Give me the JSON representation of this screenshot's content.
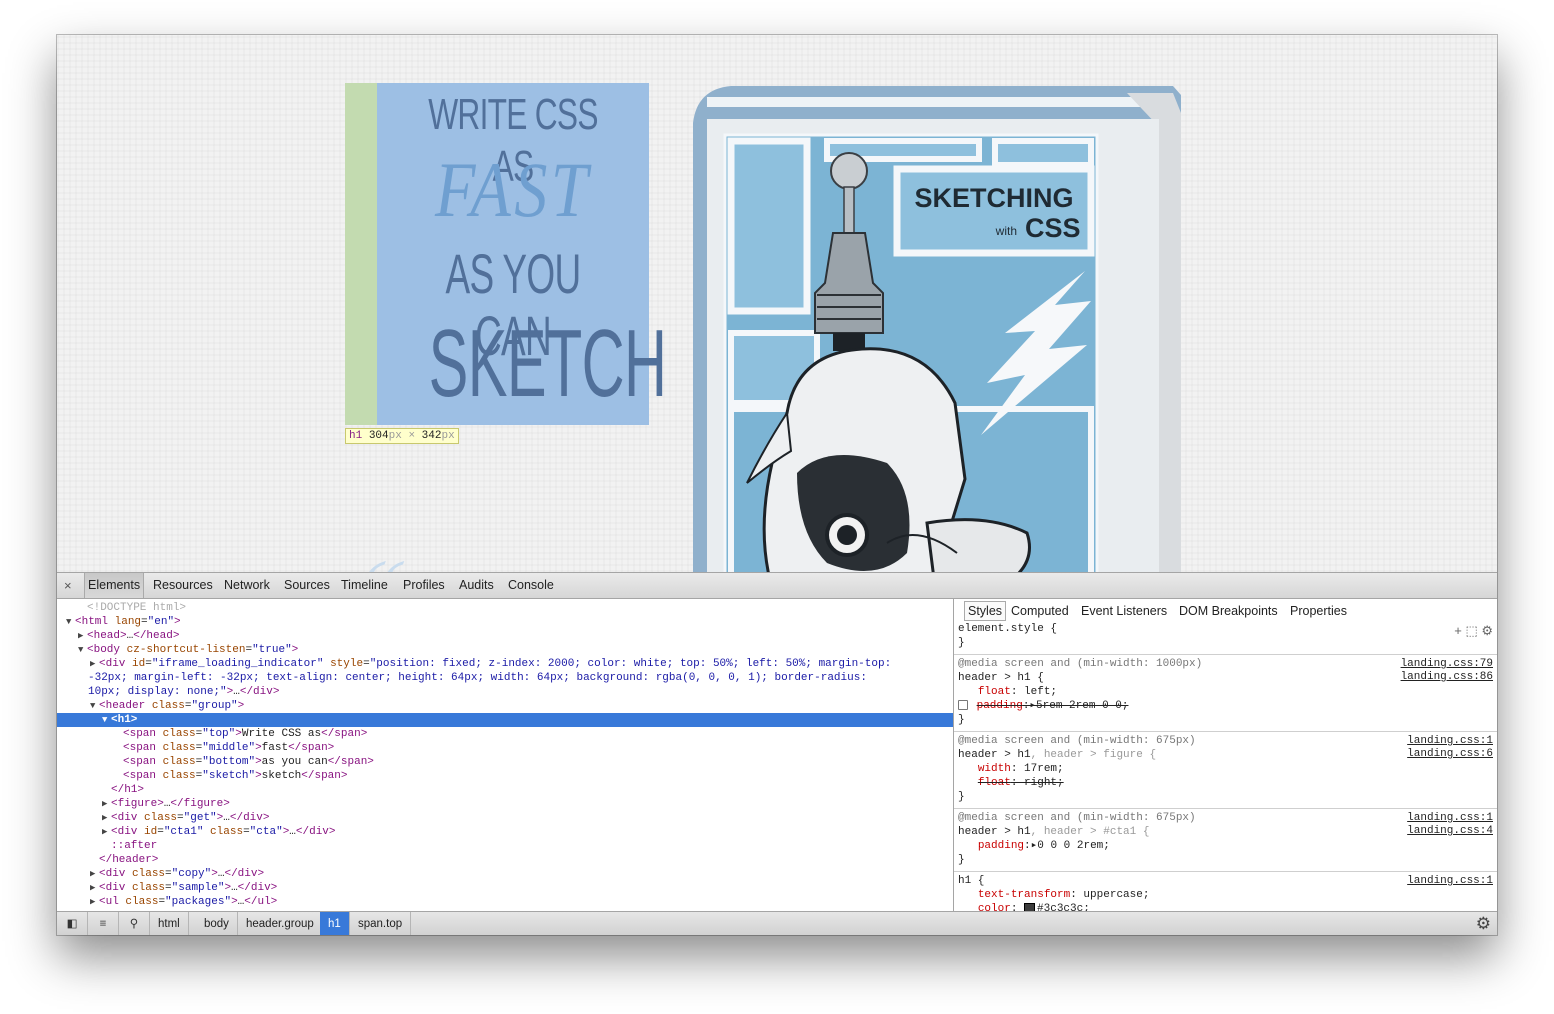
{
  "page": {
    "h1": {
      "top": "Write CSS as",
      "middle": "fast",
      "bottom": "as you can",
      "sketch": "sketch"
    },
    "dimension_tooltip": {
      "tag": "h1",
      "width": "304",
      "height": "342",
      "unit": "px",
      "times": "×"
    },
    "book": {
      "title": "SKETCHING",
      "with": "with",
      "css": "CSS"
    },
    "colors": {
      "h1_background": "#9dbfe4",
      "padding_highlight": "#c3dbb0",
      "selection": "#3879d9"
    }
  },
  "devtools": {
    "close": "×",
    "tabs": [
      "Elements",
      "Resources",
      "Network",
      "Sources",
      "Timeline",
      "Profiles",
      "Audits",
      "Console"
    ],
    "selected_tab": "Elements",
    "dom_lines": [
      {
        "indent": 1,
        "tri": "",
        "html": "<span class='dt'>&lt;!DOCTYPE html&gt;</span>"
      },
      {
        "indent": 0,
        "tri": "▼",
        "html": "<span class='tag'>&lt;html</span> <span class='an'>lang</span>=<span class='av'>\"en\"</span><span class='tag'>&gt;</span>"
      },
      {
        "indent": 1,
        "tri": "▶",
        "html": "<span class='tag'>&lt;head&gt;</span>…<span class='tag'>&lt;/head&gt;</span>"
      },
      {
        "indent": 1,
        "tri": "▼",
        "html": "<span class='tag'>&lt;body</span> <span class='an'>cz-shortcut-listen</span>=<span class='av'>\"true\"</span><span class='tag'>&gt;</span>"
      },
      {
        "indent": 2,
        "tri": "▶",
        "html": "<span class='tag'>&lt;div</span> <span class='an'>id</span>=<span class='av'>\"iframe_loading_indicator\"</span> <span class='an'>style</span>=<span class='av'>\"position: fixed; z-index: 2000; color: white; top: 50%; left: 50%; margin-top:</span>"
      },
      {
        "indent": -1,
        "tri": "",
        "html": "<span class='av'>-32px; margin-left: -32px; text-align: center; height: 64px; width: 64px; background: rgba(0, 0, 0, 1); border-radius:</span>"
      },
      {
        "indent": -1,
        "tri": "",
        "html": "<span class='av'>10px; display: none;\"</span><span class='tag'>&gt;</span>…<span class='tag'>&lt;/div&gt;</span>"
      },
      {
        "indent": 2,
        "tri": "▼",
        "html": "<span class='tag'>&lt;header</span> <span class='an'>class</span>=<span class='av'>\"group\"</span><span class='tag'>&gt;</span>"
      },
      {
        "indent": 3,
        "tri": "▼",
        "html": "<span class='tag'>&lt;h1&gt;</span>",
        "selected": true
      },
      {
        "indent": 4,
        "tri": "",
        "html": "<span class='tag'>&lt;span</span> <span class='an'>class</span>=<span class='av'>\"top\"</span><span class='tag'>&gt;</span>Write CSS as<span class='tag'>&lt;/span&gt;</span>"
      },
      {
        "indent": 4,
        "tri": "",
        "html": "<span class='tag'>&lt;span</span> <span class='an'>class</span>=<span class='av'>\"middle\"</span><span class='tag'>&gt;</span>fast<span class='tag'>&lt;/span&gt;</span>"
      },
      {
        "indent": 4,
        "tri": "",
        "html": "<span class='tag'>&lt;span</span> <span class='an'>class</span>=<span class='av'>\"bottom\"</span><span class='tag'>&gt;</span>as you can<span class='tag'>&lt;/span&gt;</span>"
      },
      {
        "indent": 4,
        "tri": "",
        "html": "<span class='tag'>&lt;span</span> <span class='an'>class</span>=<span class='av'>\"sketch\"</span><span class='tag'>&gt;</span>sketch<span class='tag'>&lt;/span&gt;</span>"
      },
      {
        "indent": 3,
        "tri": "",
        "html": "<span class='tag'>&lt;/h1&gt;</span>"
      },
      {
        "indent": 3,
        "tri": "▶",
        "html": "<span class='tag'>&lt;figure&gt;</span>…<span class='tag'>&lt;/figure&gt;</span>"
      },
      {
        "indent": 3,
        "tri": "▶",
        "html": "<span class='tag'>&lt;div</span> <span class='an'>class</span>=<span class='av'>\"get\"</span><span class='tag'>&gt;</span>…<span class='tag'>&lt;/div&gt;</span>"
      },
      {
        "indent": 3,
        "tri": "▶",
        "html": "<span class='tag'>&lt;div</span> <span class='an'>id</span>=<span class='av'>\"cta1\"</span> <span class='an'>class</span>=<span class='av'>\"cta\"</span><span class='tag'>&gt;</span>…<span class='tag'>&lt;/div&gt;</span>"
      },
      {
        "indent": 3,
        "tri": "",
        "html": "<span class='pse'>::after</span>"
      },
      {
        "indent": 2,
        "tri": "",
        "html": "<span class='tag'>&lt;/header&gt;</span>"
      },
      {
        "indent": 2,
        "tri": "▶",
        "html": "<span class='tag'>&lt;div</span> <span class='an'>class</span>=<span class='av'>\"copy\"</span><span class='tag'>&gt;</span>…<span class='tag'>&lt;/div&gt;</span>"
      },
      {
        "indent": 2,
        "tri": "▶",
        "html": "<span class='tag'>&lt;div</span> <span class='an'>class</span>=<span class='av'>\"sample\"</span><span class='tag'>&gt;</span>…<span class='tag'>&lt;/div&gt;</span>"
      },
      {
        "indent": 2,
        "tri": "▶",
        "html": "<span class='tag'>&lt;ul</span> <span class='an'>class</span>=<span class='av'>\"packages\"</span><span class='tag'>&gt;</span>…<span class='tag'>&lt;/ul&gt;</span>"
      }
    ],
    "styles_tabs": [
      "Styles",
      "Computed",
      "Event Listeners",
      "DOM Breakpoints",
      "Properties"
    ],
    "selected_styles_tab": "Styles",
    "style_icons": {
      "add": "+",
      "toggle": "⬚",
      "gear": "⚙"
    },
    "style_rules": [
      {
        "lines": [
          "element.style {",
          "}"
        ]
      },
      {
        "media": "@media screen and (min-width: 1000px)",
        "selector": "header > h1 {",
        "sources": [
          "landing.css:79",
          "landing.css:86"
        ],
        "props": [
          {
            "name": "float",
            "value": "left;",
            "struck": false
          },
          {
            "name": "padding",
            "value": "5rem 2rem 0 0;",
            "struck": true,
            "checkbox": true,
            "arrow": true
          }
        ]
      },
      {
        "media": "@media screen and (min-width: 675px)",
        "selector_main": "header > h1",
        "selector_rest": ", header > figure {",
        "sources": [
          "landing.css:1",
          "landing.css:6"
        ],
        "props": [
          {
            "name": "width",
            "value": "17rem;",
            "struck": false
          },
          {
            "name": "float",
            "value": "right;",
            "struck": true
          }
        ]
      },
      {
        "media": "@media screen and (min-width: 675px)",
        "selector_main": "header > h1",
        "selector_rest": ", header > #cta1 {",
        "sources": [
          "landing.css:1",
          "landing.css:4"
        ],
        "props": [
          {
            "name": "padding",
            "value": "0 0 0 2rem;",
            "struck": false,
            "arrow": true
          }
        ]
      },
      {
        "selector": "h1 {",
        "sources": [
          "landing.css:1"
        ],
        "props": [
          {
            "name": "text-transform",
            "value": "uppercase;",
            "struck": false
          },
          {
            "name": "color",
            "value": "#3c3c3c;",
            "struck": false,
            "swatch": true
          }
        ]
      }
    ],
    "breadcrumbs": [
      "html",
      "body",
      "header.group",
      "h1",
      "span.top"
    ],
    "selected_breadcrumb": "h1"
  }
}
